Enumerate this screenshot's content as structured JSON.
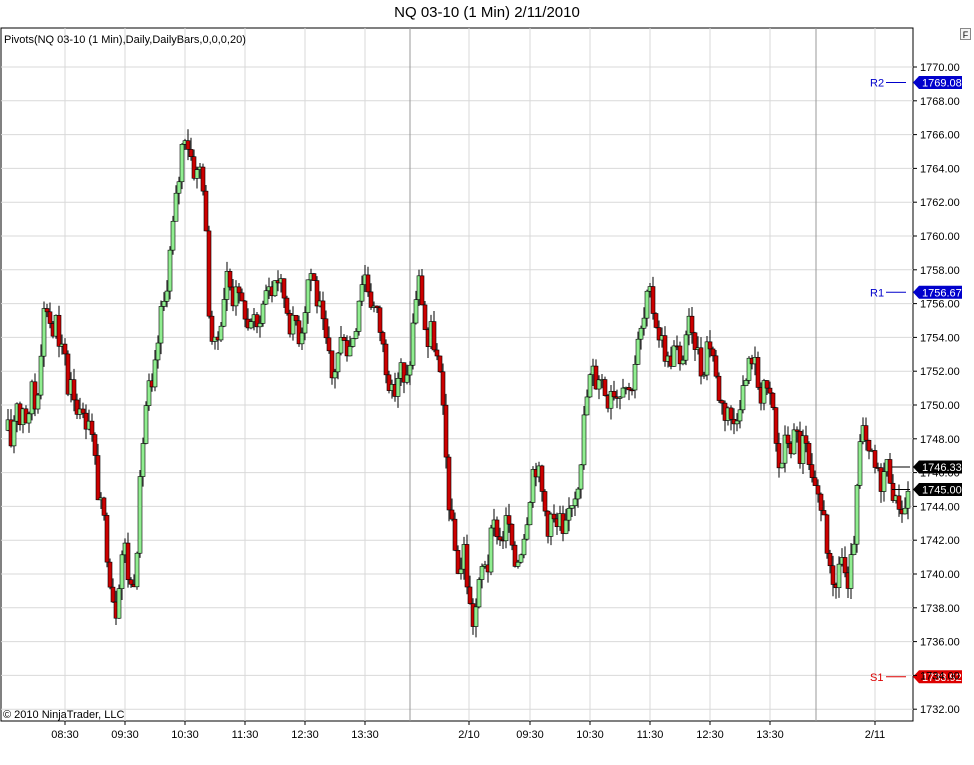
{
  "title": "NQ 03-10 (1 Min)  2/11/2010",
  "indicator_label": "Pivots(NQ 03-10 (1 Min),Daily,DailyBars,0,0,0,20)",
  "copyright": "© 2010 NinjaTrader, LLC",
  "panel_button": "F",
  "colors": {
    "up": "#90ee90",
    "down": "#cc0000",
    "wick": "#000000",
    "pivot": "#0000cc",
    "support": "#dd0000",
    "grid": "#d9d9d9"
  },
  "chart_data": {
    "type": "candlestick",
    "title": "NQ 03-10 (1 Min)  2/11/2010",
    "xlabel": "",
    "ylabel": "",
    "ylim": [
      1731,
      1771.2
    ],
    "y_ticks": [
      1732,
      1734,
      1736,
      1738,
      1740,
      1742,
      1744,
      1746,
      1748,
      1750,
      1752,
      1754,
      1756,
      1758,
      1760,
      1762,
      1764,
      1766,
      1768,
      1770
    ],
    "y_tick_labels": [
      "1732.00",
      "1734.00",
      "1736.00",
      "1738.00",
      "1740.00",
      "1742.00",
      "1744.00",
      "1746.00",
      "1748.00",
      "1750.00",
      "1752.00",
      "1754.00",
      "1756.00",
      "1758.00",
      "1760.00",
      "1762.00",
      "1764.00",
      "1766.00",
      "1768.00",
      "1770.00"
    ],
    "x_ticks": [
      "08:30",
      "09:30",
      "10:30",
      "11:30",
      "12:30",
      "13:30",
      "2/10",
      "09:30",
      "10:30",
      "11:30",
      "12:30",
      "13:30",
      "2/11"
    ],
    "session_breaks": [
      "2/10",
      "2/11"
    ],
    "grid": true,
    "close_path": [
      [
        0,
        1754.0
      ],
      [
        2,
        1755.5
      ],
      [
        5,
        1752.0
      ],
      [
        8,
        1748.5
      ],
      [
        12,
        1747.5
      ],
      [
        16,
        1751.0
      ],
      [
        20,
        1749.0
      ],
      [
        24,
        1750.5
      ],
      [
        28,
        1748.0
      ],
      [
        32,
        1751.5
      ],
      [
        36,
        1749.5
      ],
      [
        40,
        1753.0
      ],
      [
        44,
        1755.5
      ],
      [
        48,
        1756.0
      ],
      [
        52,
        1754.0
      ],
      [
        56,
        1755.0
      ],
      [
        60,
        1752.5
      ],
      [
        64,
        1753.5
      ],
      [
        68,
        1751.0
      ],
      [
        72,
        1752.0
      ],
      [
        76,
        1749.5
      ],
      [
        80,
        1750.5
      ],
      [
        84,
        1748.5
      ],
      [
        88,
        1750.0
      ],
      [
        92,
        1748.0
      ],
      [
        96,
        1746.0
      ],
      [
        100,
        1744.0
      ],
      [
        104,
        1743.0
      ],
      [
        108,
        1741.0
      ],
      [
        112,
        1739.0
      ],
      [
        116,
        1738.0
      ],
      [
        120,
        1740.5
      ],
      [
        124,
        1742.0
      ],
      [
        128,
        1740.0
      ],
      [
        132,
        1739.0
      ],
      [
        136,
        1741.0
      ],
      [
        140,
        1745.0
      ],
      [
        144,
        1749.0
      ],
      [
        148,
        1751.0
      ],
      [
        152,
        1750.5
      ],
      [
        156,
        1752.5
      ],
      [
        160,
        1755.0
      ],
      [
        164,
        1756.0
      ],
      [
        168,
        1758.0
      ],
      [
        172,
        1760.0
      ],
      [
        176,
        1762.0
      ],
      [
        180,
        1764.0
      ],
      [
        184,
        1766.5
      ],
      [
        188,
        1765.5
      ],
      [
        192,
        1764.5
      ],
      [
        196,
        1763.5
      ],
      [
        200,
        1764.0
      ],
      [
        204,
        1763.0
      ],
      [
        208,
        1756.5
      ],
      [
        212,
        1754.0
      ],
      [
        216,
        1753.0
      ],
      [
        220,
        1755.0
      ],
      [
        224,
        1756.5
      ],
      [
        228,
        1758.0
      ],
      [
        232,
        1756.0
      ],
      [
        236,
        1757.5
      ],
      [
        240,
        1755.5
      ],
      [
        244,
        1756.0
      ],
      [
        248,
        1754.5
      ],
      [
        252,
        1755.5
      ],
      [
        256,
        1754.0
      ],
      [
        260,
        1755.5
      ],
      [
        264,
        1756.0
      ],
      [
        268,
        1757.5
      ],
      [
        272,
        1756.5
      ],
      [
        276,
        1758.0
      ],
      [
        280,
        1757.0
      ],
      [
        284,
        1756.5
      ],
      [
        288,
        1755.5
      ],
      [
        292,
        1754.5
      ],
      [
        296,
        1755.0
      ],
      [
        300,
        1754.0
      ],
      [
        304,
        1755.5
      ],
      [
        308,
        1757.5
      ],
      [
        312,
        1758.0
      ],
      [
        316,
        1756.5
      ],
      [
        320,
        1755.5
      ],
      [
        324,
        1754.0
      ],
      [
        328,
        1753.0
      ],
      [
        332,
        1751.5
      ],
      [
        336,
        1752.5
      ],
      [
        340,
        1753.5
      ],
      [
        344,
        1754.5
      ],
      [
        348,
        1753.0
      ],
      [
        352,
        1754.0
      ],
      [
        356,
        1755.0
      ],
      [
        360,
        1757.0
      ],
      [
        364,
        1758.0
      ],
      [
        368,
        1757.0
      ],
      [
        372,
        1756.0
      ],
      [
        376,
        1755.5
      ],
      [
        380,
        1754.5
      ],
      [
        384,
        1753.0
      ],
      [
        388,
        1752.0
      ],
      [
        392,
        1750.5
      ],
      [
        396,
        1751.0
      ],
      [
        400,
        1752.5
      ],
      [
        404,
        1751.0
      ],
      [
        408,
        1751.5
      ],
      [
        412,
        1754.0
      ],
      [
        416,
        1756.5
      ],
      [
        420,
        1757.5
      ],
      [
        424,
        1755.0
      ],
      [
        428,
        1753.5
      ],
      [
        432,
        1754.5
      ],
      [
        436,
        1753.0
      ],
      [
        440,
        1751.5
      ],
      [
        444,
        1748.5
      ],
      [
        448,
        1745.0
      ],
      [
        452,
        1742.5
      ],
      [
        456,
        1741.0
      ],
      [
        460,
        1740.0
      ],
      [
        464,
        1741.5
      ],
      [
        468,
        1739.0
      ],
      [
        472,
        1737.0
      ],
      [
        476,
        1738.0
      ],
      [
        480,
        1739.5
      ],
      [
        484,
        1741.0
      ],
      [
        488,
        1740.5
      ],
      [
        492,
        1742.5
      ],
      [
        496,
        1743.0
      ],
      [
        500,
        1742.0
      ],
      [
        504,
        1742.5
      ],
      [
        508,
        1743.5
      ],
      [
        512,
        1741.0
      ],
      [
        516,
        1740.5
      ],
      [
        520,
        1741.5
      ],
      [
        524,
        1742.5
      ],
      [
        528,
        1744.0
      ],
      [
        532,
        1746.0
      ],
      [
        536,
        1746.5
      ],
      [
        540,
        1745.5
      ],
      [
        544,
        1744.0
      ],
      [
        548,
        1743.0
      ],
      [
        552,
        1743.5
      ],
      [
        556,
        1742.5
      ],
      [
        560,
        1743.0
      ],
      [
        564,
        1741.5
      ],
      [
        568,
        1743.5
      ],
      [
        572,
        1744.5
      ],
      [
        576,
        1745.0
      ],
      [
        580,
        1746.5
      ],
      [
        584,
        1749.0
      ],
      [
        588,
        1751.0
      ],
      [
        592,
        1752.0
      ],
      [
        596,
        1751.5
      ],
      [
        600,
        1752.0
      ],
      [
        604,
        1751.0
      ],
      [
        608,
        1750.5
      ],
      [
        612,
        1751.5
      ],
      [
        616,
        1750.5
      ],
      [
        620,
        1751.0
      ],
      [
        624,
        1752.0
      ],
      [
        628,
        1750.5
      ],
      [
        632,
        1751.5
      ],
      [
        636,
        1753.0
      ],
      [
        640,
        1754.0
      ],
      [
        644,
        1755.0
      ],
      [
        648,
        1756.5
      ],
      [
        652,
        1756.0
      ],
      [
        656,
        1755.0
      ],
      [
        660,
        1754.0
      ],
      [
        664,
        1753.5
      ],
      [
        668,
        1752.5
      ],
      [
        672,
        1753.0
      ],
      [
        676,
        1753.5
      ],
      [
        680,
        1752.0
      ],
      [
        684,
        1753.5
      ],
      [
        688,
        1755.0
      ],
      [
        692,
        1753.5
      ],
      [
        696,
        1754.0
      ],
      [
        700,
        1752.0
      ],
      [
        704,
        1752.5
      ],
      [
        708,
        1754.0
      ],
      [
        712,
        1753.5
      ],
      [
        716,
        1751.5
      ],
      [
        720,
        1750.5
      ],
      [
        724,
        1749.5
      ],
      [
        728,
        1750.0
      ],
      [
        732,
        1748.5
      ],
      [
        736,
        1749.5
      ],
      [
        740,
        1750.5
      ],
      [
        744,
        1751.0
      ],
      [
        748,
        1752.0
      ],
      [
        752,
        1753.0
      ],
      [
        756,
        1752.0
      ],
      [
        760,
        1750.5
      ],
      [
        764,
        1751.5
      ],
      [
        768,
        1750.0
      ],
      [
        772,
        1750.5
      ],
      [
        776,
        1747.5
      ],
      [
        780,
        1746.0
      ],
      [
        784,
        1747.5
      ],
      [
        788,
        1748.0
      ],
      [
        792,
        1747.5
      ],
      [
        796,
        1748.5
      ],
      [
        800,
        1747.0
      ],
      [
        804,
        1748.0
      ],
      [
        808,
        1746.5
      ],
      [
        812,
        1745.0
      ],
      [
        816,
        1744.5
      ],
      [
        820,
        1743.5
      ],
      [
        824,
        1744.0
      ],
      [
        828,
        1741.0
      ],
      [
        832,
        1738.5
      ],
      [
        836,
        1739.0
      ],
      [
        840,
        1741.5
      ],
      [
        844,
        1740.5
      ],
      [
        848,
        1738.5
      ],
      [
        852,
        1741.0
      ],
      [
        856,
        1743.5
      ],
      [
        860,
        1747.5
      ],
      [
        864,
        1748.5
      ],
      [
        868,
        1746.5
      ],
      [
        872,
        1747.0
      ],
      [
        876,
        1746.0
      ],
      [
        880,
        1745.5
      ],
      [
        884,
        1746.0
      ],
      [
        888,
        1746.5
      ],
      [
        892,
        1745.5
      ],
      [
        896,
        1744.0
      ],
      [
        900,
        1744.5
      ],
      [
        904,
        1743.5
      ],
      [
        908,
        1745.0
      ]
    ],
    "pivot_levels": [
      {
        "name": "R2",
        "value": "1769.08"
      },
      {
        "name": "R1",
        "value": "1756.67"
      },
      {
        "name": "S1",
        "value": "1733.92"
      }
    ],
    "price_markers": [
      {
        "value": "1746.33",
        "kind": "last"
      },
      {
        "value": "1745.00",
        "kind": "current"
      }
    ]
  }
}
